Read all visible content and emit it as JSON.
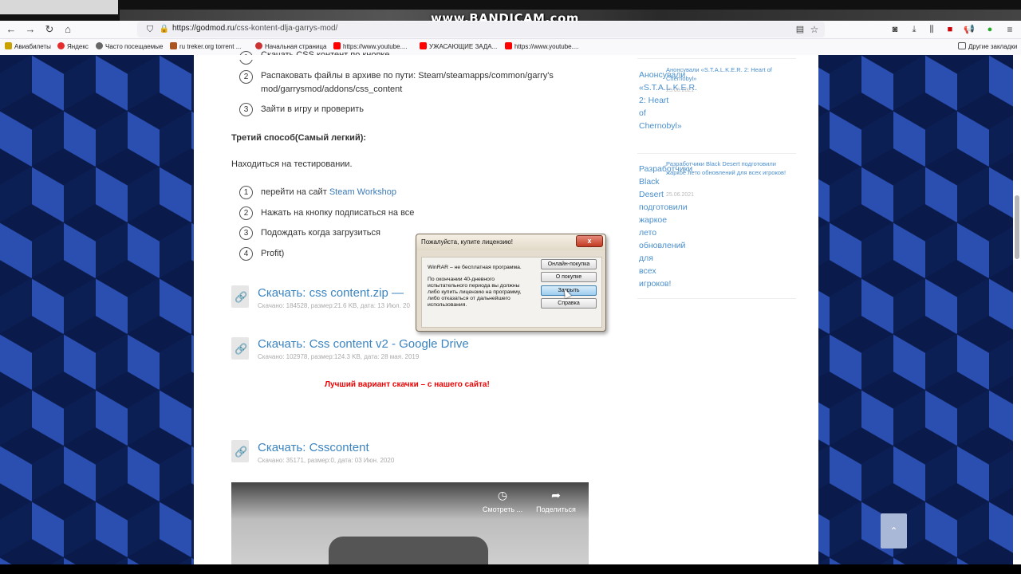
{
  "watermark": "www.BANDICAM.com",
  "browser": {
    "url_domain": "https://godmod.ru",
    "url_path": "/css-kontent-dlja-garrys-mod/",
    "bookmarks": [
      {
        "label": "Авиабилеты",
        "color": "#c9a200"
      },
      {
        "label": "Яндекс",
        "color": "#e52d2d"
      },
      {
        "label": "Часто посещаемые",
        "color": "#666666"
      },
      {
        "label": "ru treker.org torrent ...",
        "color": "#aa5522"
      },
      {
        "label": "Начальная страница",
        "color": "#cc3333"
      },
      {
        "label": "https://www.youtube....",
        "color": "#ff0000"
      },
      {
        "label": "УЖАСАЮЩИЕ ЗАДА...",
        "color": "#ff0000"
      },
      {
        "label": "https://www.youtube....",
        "color": "#ff0000"
      }
    ],
    "other_bookmarks": "Другие закладки"
  },
  "article": {
    "step_top_partial": "Скачать CSS контент по кнопке",
    "step2_num": "2",
    "step2_line1": "Распаковать файлы в архиве по пути: Steam/steamapps/common/garry's",
    "step2_line2": "mod/garrysmod/addons/css_content",
    "step3_num": "3",
    "step3": "Зайти в игру и проверить",
    "third_heading": "Третий способ(Самый легкий):",
    "third_intro": "Находиться на тестировании.",
    "list2": [
      {
        "num": "1",
        "text": "перейти на сайт ",
        "link": "Steam Workshop"
      },
      {
        "num": "2",
        "text": "Нажать на кнопку подписаться на все"
      },
      {
        "num": "3",
        "text": "Подождать когда загрузиться"
      },
      {
        "num": "4",
        "text": "Profit)"
      }
    ],
    "downloads": [
      {
        "title": "Скачать: css content.zip —",
        "meta": "Скачано: 184528, размер:21.6 KB, дата: 13 Июл. 20"
      },
      {
        "title": "Скачать: Css content v2 - Google Drive",
        "meta": "Скачано: 102978, размер:124.3 KB, дата: 28 мая. 2019"
      },
      {
        "title": "Скачать: Csscontent",
        "meta": "Скачано: 35171, размер:0, дата: 03 Июн. 2020"
      }
    ],
    "best_variant": "Лучший вариант скачки – с нашего сайта!",
    "video_watch_later": "Смотреть ...",
    "video_share": "Поделиться"
  },
  "sidebar": {
    "posts": [
      {
        "big": "Анонсували «S.T.A.L.K.E.R. 2: Heart of Chernobyl»",
        "small": "Анонсували «S.T.A.L.K.E.R. 2: Heart of Chernobyl»",
        "date": "25.06.2021"
      },
      {
        "big": "Разработчики Black Desert подготовили жаркое лето обновлений для всех игроков!",
        "small": "Разработчики Black Desert подготовили жаркое лето обновлений для всех игроков!",
        "date": "25.06.2021"
      }
    ]
  },
  "dialog": {
    "title": "Пожалуйста, купите лицензию!",
    "close": "x",
    "msg1": "WinRAR – не бесплатная программа.",
    "msg2": "По окончании 40-дневного испытательного периода вы должны либо купить лицензию на программу, либо отказаться от дальнейшего использования.",
    "buttons": [
      "Онлайн-покупка",
      "О покупке",
      "Закрыть",
      "Справка"
    ]
  }
}
